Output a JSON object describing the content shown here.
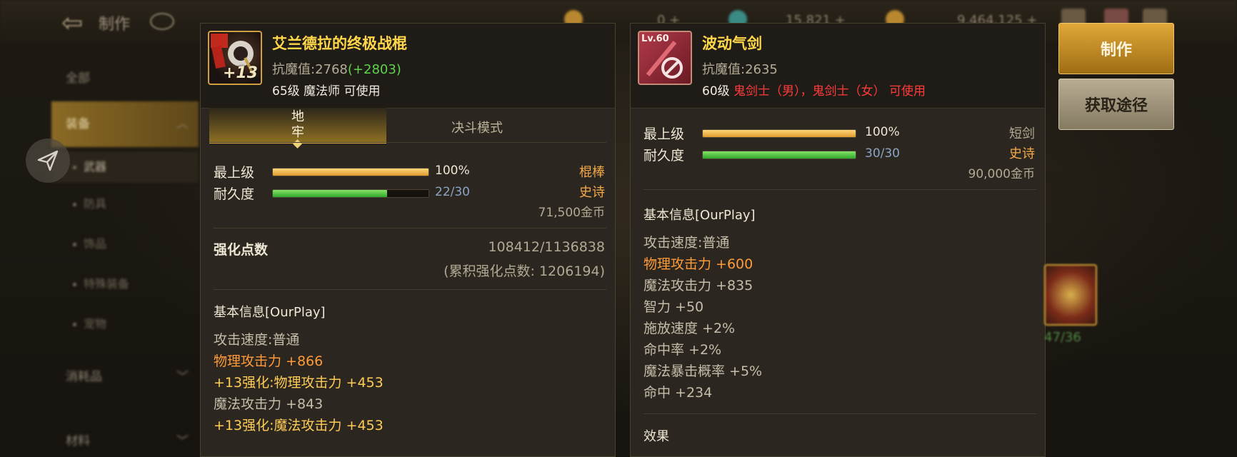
{
  "topbar": {
    "title": "制作",
    "stat1": "0 +",
    "stat2": "15,821 +",
    "stat3": "9,464,125 +"
  },
  "sidebar": {
    "items": [
      {
        "label": "全部"
      },
      {
        "label": "装备"
      },
      {
        "label": "武器"
      },
      {
        "label": "防具"
      },
      {
        "label": "饰品"
      },
      {
        "label": "特殊装备"
      },
      {
        "label": "宠物"
      },
      {
        "label": "消耗品"
      },
      {
        "label": "材料"
      }
    ]
  },
  "left_item": {
    "name": "艾兰德拉的终极战棍",
    "icon_badge": "+13",
    "resist_label": "抗魔值:",
    "resist_value": "2768",
    "resist_bonus": "(+2803)",
    "level_text": "65级 魔法师 可使用",
    "tabs": [
      {
        "label": "地\n牢"
      },
      {
        "label": "决斗模式"
      }
    ],
    "max_level_label": "最上级",
    "max_level_value": "100%",
    "max_level_fraction": 1.0,
    "durability_label": "耐久度",
    "durability_value": "22/30",
    "durability_fraction": 0.7333,
    "category": "棍棒",
    "rarity": "史诗",
    "price": "71,500金币",
    "enhance_label": "强化点数",
    "enhance_value": "108412/1136838",
    "enhance_total": "(累积强化点数: 1206194)",
    "basic_info_title": "基本信息[OurPlay]",
    "stats": [
      {
        "text": "攻击速度:普通",
        "color": "normal"
      },
      {
        "text": "物理攻击力 +866",
        "color": "orange"
      },
      {
        "text": "+13强化:物理攻击力 +453",
        "color": "gold"
      },
      {
        "text": "魔法攻击力 +843",
        "color": "normal"
      },
      {
        "text": "+13强化:魔法攻击力 +453",
        "color": "gold"
      }
    ]
  },
  "right_item": {
    "name": "波动气剑",
    "icon_level": "Lv.60",
    "resist_label": "抗魔值:",
    "resist_value": "2635",
    "level_prefix": "60级",
    "level_classes": "鬼剑士（男），鬼剑士（女）",
    "level_suffix": "可使用",
    "max_level_label": "最上级",
    "max_level_value": "100%",
    "max_level_fraction": 1.0,
    "durability_label": "耐久度",
    "durability_value": "30/30",
    "durability_fraction": 1.0,
    "category": "短剑",
    "rarity": "史诗",
    "price": "90,000金币",
    "basic_info_title": "基本信息[OurPlay]",
    "stats": [
      {
        "text": "攻击速度:普通",
        "color": "normal"
      },
      {
        "text": "物理攻击力 +600",
        "color": "orange"
      },
      {
        "text": "魔法攻击力 +835",
        "color": "normal"
      },
      {
        "text": "智力 +50",
        "color": "normal"
      },
      {
        "text": "施放速度 +2%",
        "color": "normal"
      },
      {
        "text": "命中率 +2%",
        "color": "normal"
      },
      {
        "text": "魔法暴击概率 +5%",
        "color": "normal"
      },
      {
        "text": "命中 +234",
        "color": "normal"
      }
    ],
    "effect_title": "效果"
  },
  "buttons": {
    "make_label": "制作",
    "source_label": "获取途径"
  },
  "thumb": {
    "count": "47/36"
  },
  "colors": {
    "item_name": "#ffd84a",
    "bonus_green": "#5fd24d",
    "stat_orange": "#ff9b38",
    "stat_gold": "#ffcc55",
    "restriction_red": "#ff3b3b",
    "accent_gold": "#d2a545"
  }
}
